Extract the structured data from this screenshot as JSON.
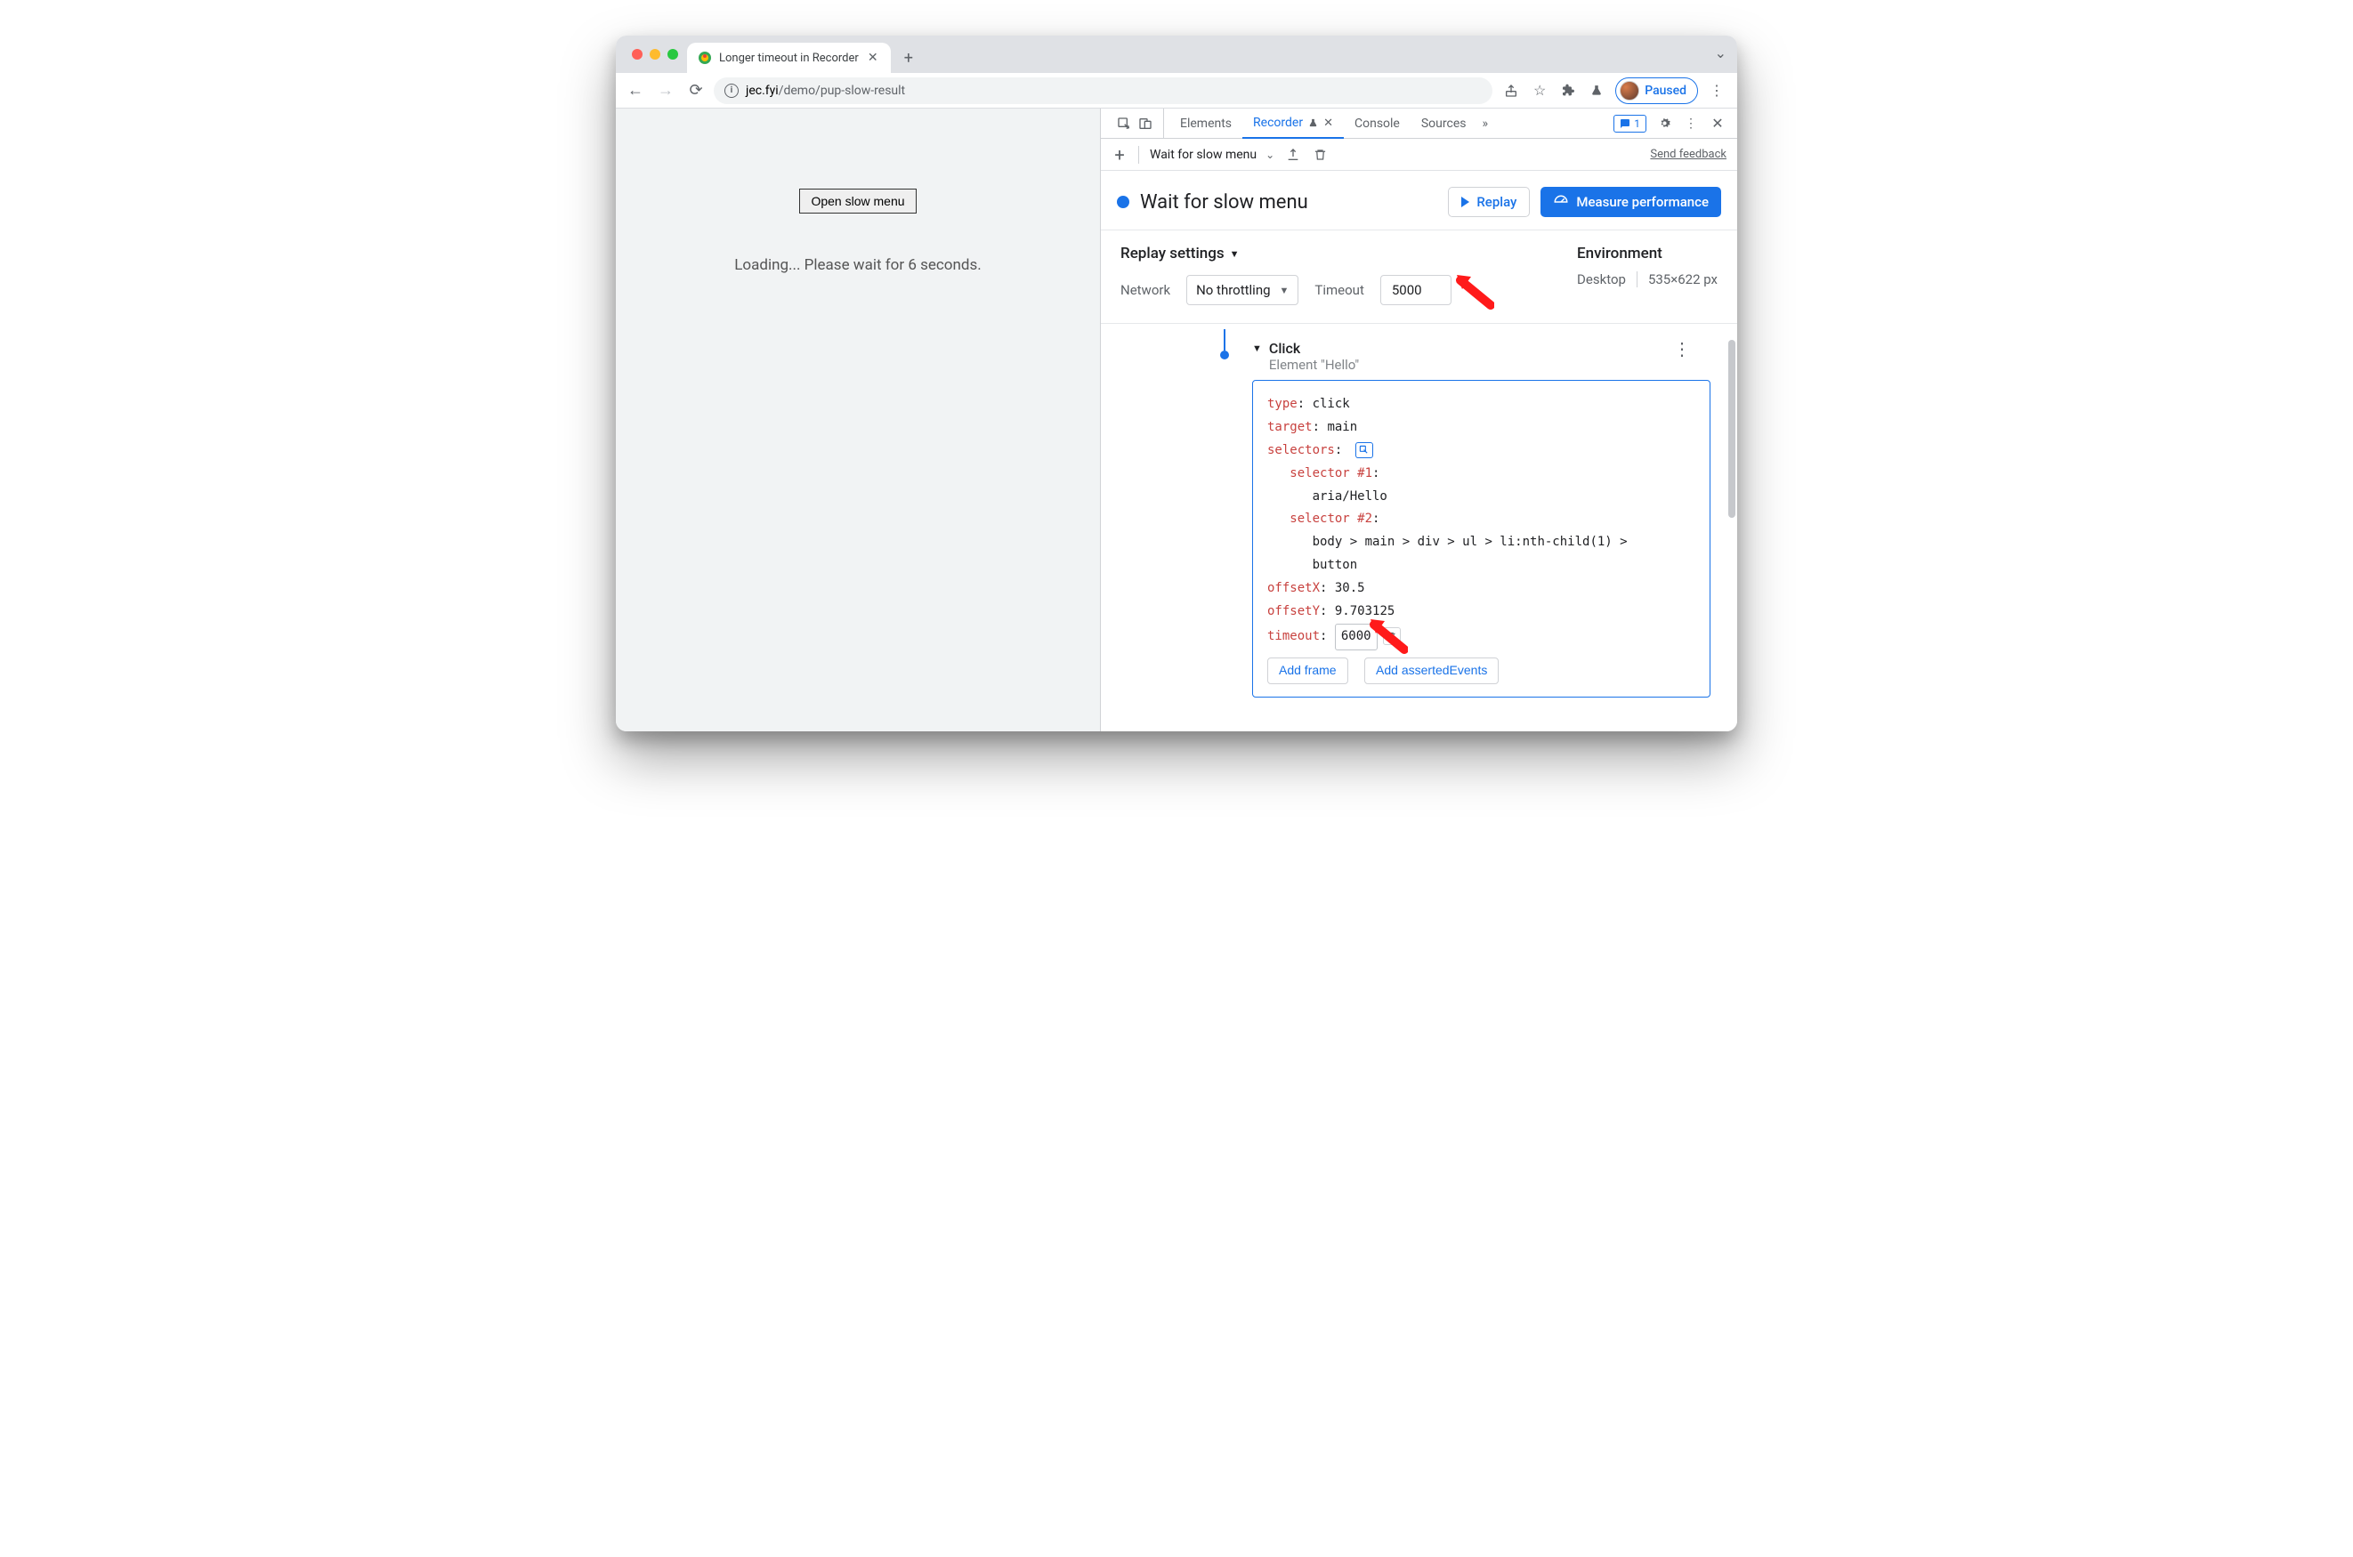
{
  "browser": {
    "tab_title": "Longer timeout in Recorder",
    "url_host": "jec.fyi",
    "url_path": "/demo/pup-slow-result",
    "paused_label": "Paused"
  },
  "page": {
    "open_button": "Open slow menu",
    "loading_text": "Loading... Please wait for 6 seconds."
  },
  "devtools": {
    "tabs": {
      "elements": "Elements",
      "recorder": "Recorder",
      "console": "Console",
      "sources": "Sources"
    },
    "issues_count": "1",
    "recorder": {
      "recording_name": "Wait for slow menu",
      "send_feedback": "Send feedback",
      "title": "Wait for slow menu",
      "replay_btn": "Replay",
      "measure_btn": "Measure performance",
      "replay_heading": "Replay settings",
      "network_label": "Network",
      "network_value": "No throttling",
      "timeout_label": "Timeout",
      "timeout_value": "5000",
      "env_heading": "Environment",
      "env_device": "Desktop",
      "env_size": "535×622 px"
    },
    "step": {
      "title": "Click",
      "subtitle": "Element \"Hello\"",
      "type_key": "type",
      "type_val": "click",
      "target_key": "target",
      "target_val": "main",
      "selectors_key": "selectors",
      "sel1_key": "selector #1",
      "sel1_val": "aria/Hello",
      "sel2_key": "selector #2",
      "sel2_val1": "body > main > div > ul > li:nth-child(1) >",
      "sel2_val2": "button",
      "offsetx_key": "offsetX",
      "offsetx_val": "30.5",
      "offsety_key": "offsetY",
      "offsety_val": "9.703125",
      "timeout_key": "timeout",
      "timeout_val": "6000",
      "add_frame": "Add frame",
      "add_asserted": "Add assertedEvents"
    }
  }
}
